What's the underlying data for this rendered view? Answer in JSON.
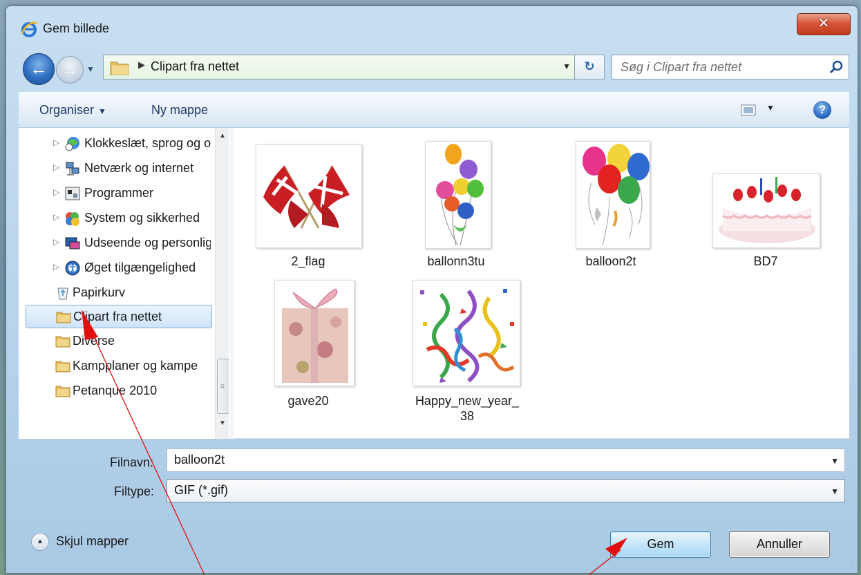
{
  "window": {
    "title": "Gem billede",
    "close_label": "✕"
  },
  "nav": {
    "back_glyph": "←",
    "forward_glyph": "→",
    "history_glyph": "▼",
    "breadcrumb_separator": "▶",
    "address_path": "Clipart fra nettet",
    "address_dropdown_glyph": "▼",
    "refresh_glyph": "↻",
    "search_placeholder": "Søg i Clipart fra nettet"
  },
  "toolbar": {
    "organise_label": "Organiser",
    "organise_caret": "▼",
    "new_folder_label": "Ny mappe",
    "view_caret": "▼",
    "help_glyph": "?"
  },
  "sidebar": {
    "items": [
      {
        "label": "Klokkeslæt, sprog og område",
        "icon": "clock-globe-icon",
        "expander": "▷"
      },
      {
        "label": "Netværk og internet",
        "icon": "network-icon",
        "expander": "▷"
      },
      {
        "label": "Programmer",
        "icon": "programs-icon",
        "expander": "▷"
      },
      {
        "label": "System og sikkerhed",
        "icon": "system-security-icon",
        "expander": "▷"
      },
      {
        "label": "Udseende og personlige indstillinger",
        "icon": "appearance-icon",
        "expander": "▷"
      },
      {
        "label": "Øget tilgængelighed",
        "icon": "accessibility-icon",
        "expander": "▷"
      },
      {
        "label": "Papirkurv",
        "icon": "recycle-bin-icon"
      },
      {
        "label": "Clipart fra nettet",
        "icon": "folder-icon",
        "selected": true
      },
      {
        "label": "Diverse",
        "icon": "folder-icon"
      },
      {
        "label": "Kampplaner og kampe",
        "icon": "folder-icon"
      },
      {
        "label": "Petanque 2010",
        "icon": "folder-icon"
      }
    ],
    "scroll_up_glyph": "▲",
    "scroll_down_glyph": "▼",
    "scroll_grip_glyph": "≡"
  },
  "files": [
    {
      "name": "2_flag",
      "icon": "danish-flags-thumbnail"
    },
    {
      "name": "ballonn3tu",
      "icon": "balloons-thumbnail"
    },
    {
      "name": "balloon2t",
      "icon": "balloon-bunch-thumbnail"
    },
    {
      "name": "BD7",
      "icon": "birthday-cake-thumbnail"
    },
    {
      "name": "gave20",
      "icon": "gift-box-thumbnail"
    },
    {
      "name": "Happy_new_year_38",
      "icon": "confetti-thumbnail"
    }
  ],
  "form": {
    "filename_label": "Filnavn:",
    "filename_value": "balloon2t",
    "filetype_label": "Filtype:",
    "filetype_value": "GIF (*.gif)",
    "dropdown_glyph": "▼",
    "hide_folders_label": "Skjul mapper",
    "hide_folders_glyph": "▲",
    "save_label": "Gem",
    "cancel_label": "Annuller",
    "resize_grip_glyph": "⋰"
  },
  "colors": {
    "annotation_arrow": "#e01010",
    "selected_item_border": "#84acdd",
    "save_button_border": "#3c7fb1"
  }
}
